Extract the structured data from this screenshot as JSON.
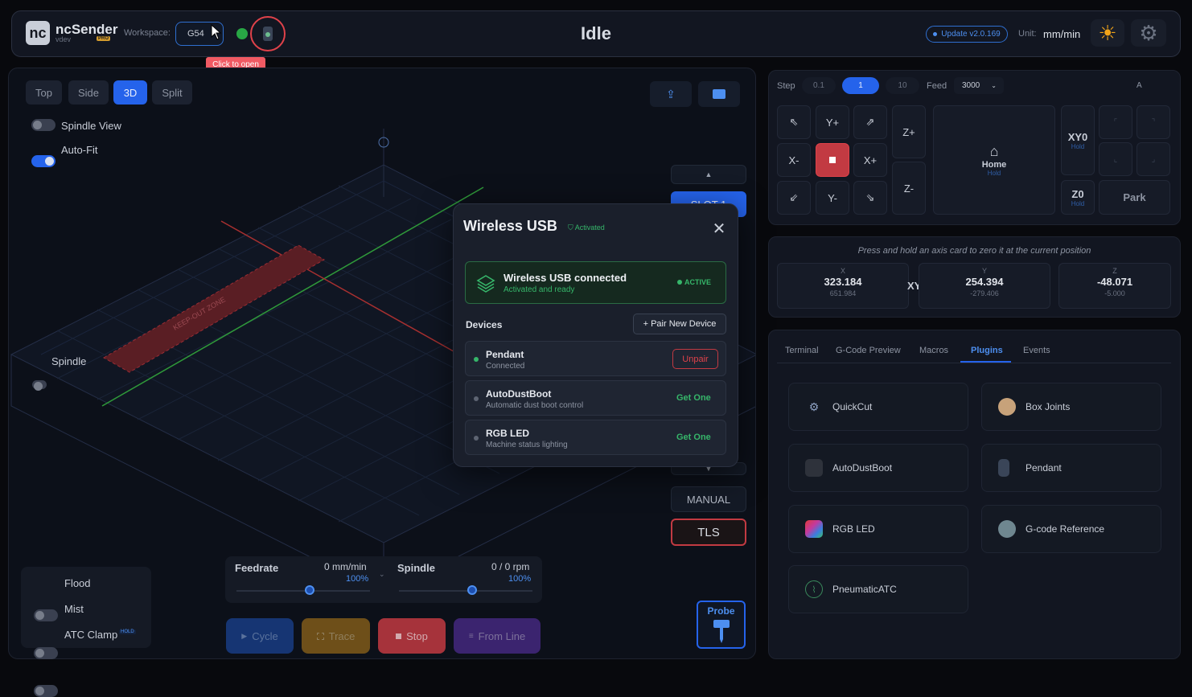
{
  "header": {
    "logo": "nc",
    "brand": "ncSender",
    "brand_sub": "vdev",
    "pro_badge": "PRO",
    "workspace_label": "Workspace:",
    "workspace_value": "G54",
    "tooltip": "Click to open",
    "status": "Idle",
    "update_label": "Update v2.0.169",
    "unit_label": "Unit:",
    "unit_value": "mm/min"
  },
  "viewer": {
    "views": [
      "Top",
      "Side",
      "3D",
      "Split"
    ],
    "active_view": "3D",
    "toggles": [
      {
        "label": "Spindle View",
        "on": false
      },
      {
        "label": "Auto-Fit",
        "on": true
      }
    ],
    "spindle_label": "Spindle",
    "keepout_label": "KEEP-OUT ZONE",
    "slot_label": "SLOT 1",
    "manual_label": "MANUAL",
    "tls_label": "TLS",
    "bottom_toggles": [
      {
        "label": "Flood",
        "on": false
      },
      {
        "label": "Mist",
        "on": false
      },
      {
        "label": "ATC Clamp",
        "on": false,
        "badge": "HOLD"
      }
    ],
    "feedrate": {
      "label": "Feedrate",
      "value": "0 mm/min",
      "pct": "100%",
      "level": 0.55
    },
    "spindle": {
      "label": "Spindle",
      "value": "0 / 0 rpm",
      "pct": "100%",
      "level": 0.55
    },
    "actions": [
      {
        "label": "Cycle",
        "icon": "play-icon",
        "color": "#1d4fb0"
      },
      {
        "label": "Trace",
        "icon": "trace-icon",
        "color": "#b07a1a"
      },
      {
        "label": "Stop",
        "icon": "stop-icon",
        "color": "#c23a42"
      },
      {
        "label": "From Line",
        "icon": "list-icon",
        "color": "#5b32a8"
      }
    ],
    "probe_label": "Probe"
  },
  "modal": {
    "title": "Wireless USB",
    "activated": "Activated",
    "conn_title": "Wireless USB connected",
    "conn_sub": "Activated and ready",
    "conn_badge": "ACTIVE",
    "devices_label": "Devices",
    "pair_label": "+ Pair New Device",
    "devices": [
      {
        "name": "Pendant",
        "sub": "Connected",
        "action": "Unpair",
        "connected": true
      },
      {
        "name": "AutoDustBoot",
        "sub": "Automatic dust boot control",
        "action": "Get One",
        "connected": false
      },
      {
        "name": "RGB LED",
        "sub": "Machine status lighting",
        "action": "Get One",
        "connected": false
      }
    ]
  },
  "jog": {
    "step_label": "Step",
    "steps": [
      "0.1",
      "1",
      "10"
    ],
    "active_step": "1",
    "feed_label": "Feed",
    "feed_value": "3000",
    "a_label": "A",
    "yplus": "Y+",
    "yminus": "Y-",
    "xplus": "X+",
    "xminus": "X-",
    "zplus": "Z+",
    "zminus": "Z-",
    "home_label": "Home",
    "hold": "Hold",
    "xy0": "XY0",
    "z0": "Z0",
    "park": "Park"
  },
  "position": {
    "hint": "Press and hold an axis card to zero it at the current position",
    "x": {
      "label": "X",
      "value": "323.184",
      "sub": "651.984"
    },
    "xy_label": "XY",
    "y": {
      "label": "Y",
      "value": "254.394",
      "sub": "-279.406"
    },
    "z": {
      "label": "Z",
      "value": "-48.071",
      "sub": "-5.000"
    }
  },
  "plugins": {
    "tabs": [
      "Terminal",
      "G-Code Preview",
      "Macros",
      "Plugins",
      "Events"
    ],
    "active_tab": "Plugins",
    "items": [
      {
        "name": "QuickCut",
        "icon": "gear-saw-icon",
        "color": "#6b7da0"
      },
      {
        "name": "Box Joints",
        "icon": "box-joint-icon",
        "color": "#c7a27a"
      },
      {
        "name": "AutoDustBoot",
        "icon": "dustboot-icon",
        "color": "#5a5f6a"
      },
      {
        "name": "Pendant",
        "icon": "pendant-icon",
        "color": "#3a4558"
      },
      {
        "name": "RGB LED",
        "icon": "rgb-icon",
        "color": "#c33a9f"
      },
      {
        "name": "G-code Reference",
        "icon": "book-icon",
        "color": "#6f8790"
      },
      {
        "name": "PneumaticATC",
        "icon": "atc-icon",
        "color": "#3a8a5c"
      }
    ]
  }
}
